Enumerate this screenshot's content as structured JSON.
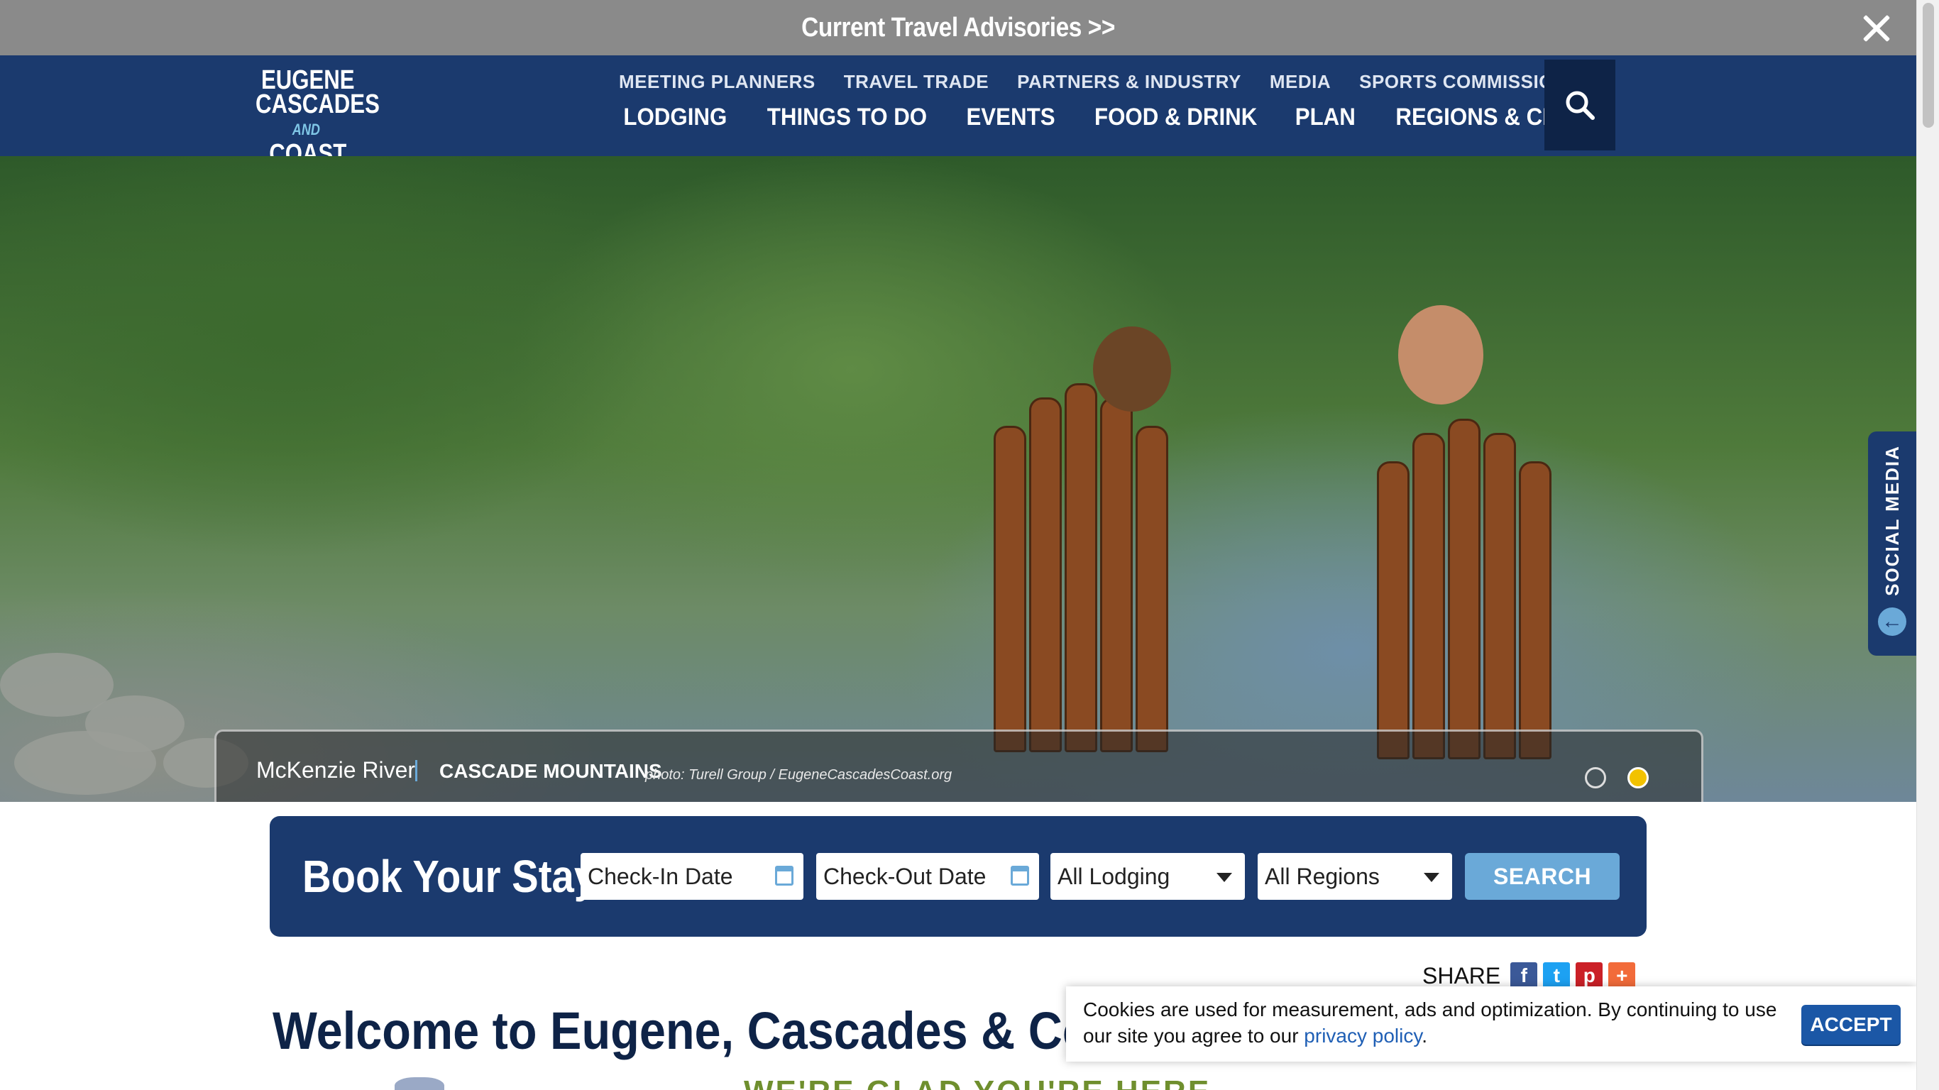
{
  "advisory": {
    "text": "Current Travel Advisories >>",
    "close_icon": "close-icon"
  },
  "logo": {
    "line1": "EUGENE",
    "line2": "CASCADES",
    "and": "AND",
    "line3": "COAST"
  },
  "nav": {
    "top": [
      "MEETING PLANNERS",
      "TRAVEL TRADE",
      "PARTNERS & INDUSTRY",
      "MEDIA",
      "SPORTS COMMISSION"
    ],
    "main": [
      "LODGING",
      "THINGS TO DO",
      "EVENTS",
      "FOOD & DRINK",
      "PLAN",
      "REGIONS & CITIES"
    ],
    "search_icon": "search-icon"
  },
  "hero": {
    "place": "McKenzie River",
    "region": "CASCADE MOUNTAINS",
    "credit": "photo: Turell Group / EugeneCascadesCoast.org",
    "slides": 2,
    "active_slide": 2
  },
  "social": {
    "label": "SOCIAL MEDIA",
    "arrow_icon": "arrow-left-icon"
  },
  "booking": {
    "title": "Book Your Stay",
    "checkin_placeholder": "Check-In Date",
    "checkout_placeholder": "Check-Out Date",
    "lodging_selected": "All Lodging",
    "regions_selected": "All Regions",
    "search_label": "SEARCH"
  },
  "share": {
    "label": "SHARE",
    "icons": {
      "facebook": "f",
      "twitter": "t",
      "pinterest": "p",
      "plus": "+"
    }
  },
  "welcome": {
    "title": "Welcome to Eugene, Cascades & Coast",
    "subtitle": "WE'RE GLAD YOU'RE HERE"
  },
  "cookie": {
    "text_before": "Cookies are used for measurement, ads and optimization. By continuing to use our site you agree to our ",
    "link": "privacy policy",
    "text_after": ".",
    "accept_label": "ACCEPT"
  },
  "colors": {
    "navy": "#1b3a6e",
    "dark_navy": "#0e2347",
    "light_blue": "#6aa9d8",
    "advisory_gray": "#8a8a8a",
    "green": "#6f8f2e"
  }
}
